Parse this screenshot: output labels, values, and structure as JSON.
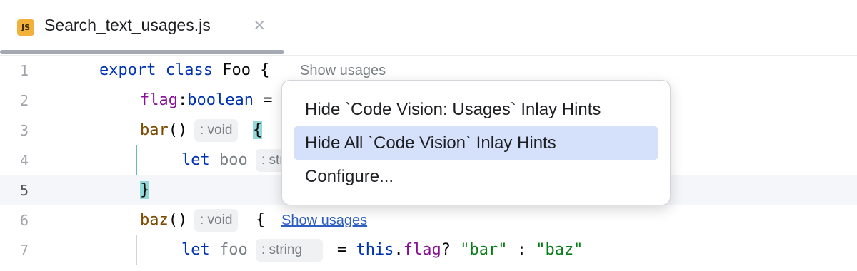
{
  "tab": {
    "icon_label": "JS",
    "icon": "javascript-file-icon",
    "title": "Search_text_usages.js",
    "close_glyph": "×"
  },
  "editor": {
    "line_numbers": [
      "1",
      "2",
      "3",
      "4",
      "5",
      "6",
      "7"
    ],
    "current_line": "5",
    "lines": {
      "l1": {
        "export": "export",
        "class": "class",
        "name": "Foo",
        "brace": "{"
      },
      "l2": {
        "field": "flag",
        "colon": ":",
        "type": "boolean",
        "eq": "="
      },
      "l3": {
        "method": "bar",
        "parens": "()",
        "hint": ": void",
        "brace": "{"
      },
      "l4": {
        "let": "let",
        "var": "boo",
        "hint": ": str"
      },
      "l5": {
        "brace": "}"
      },
      "l6": {
        "method": "baz",
        "parens": "()",
        "hint": ": void",
        "brace": "{"
      },
      "l7": {
        "let": "let",
        "var": "foo",
        "hint": ": string",
        "eq": "=",
        "this": "this",
        "dot": ".",
        "field": "flag",
        "q": "?",
        "str1": "\"bar\"",
        "colon": ":",
        "str2": "\"baz\""
      }
    },
    "code_vision": {
      "class_usages": "Show usages",
      "baz_usages": "Show usages"
    }
  },
  "context_menu": {
    "items": [
      {
        "label": "Hide `Code Vision: Usages` Inlay Hints",
        "selected": false
      },
      {
        "label": "Hide All `Code Vision` Inlay Hints",
        "selected": true
      },
      {
        "label": "Configure...",
        "selected": false
      }
    ]
  },
  "colors": {
    "keyword": "#0033b3",
    "field": "#871094",
    "string": "#067d17",
    "selection": "#d5e0fb",
    "brace_match": "#93d9d9",
    "link": "#2f5fc3"
  }
}
